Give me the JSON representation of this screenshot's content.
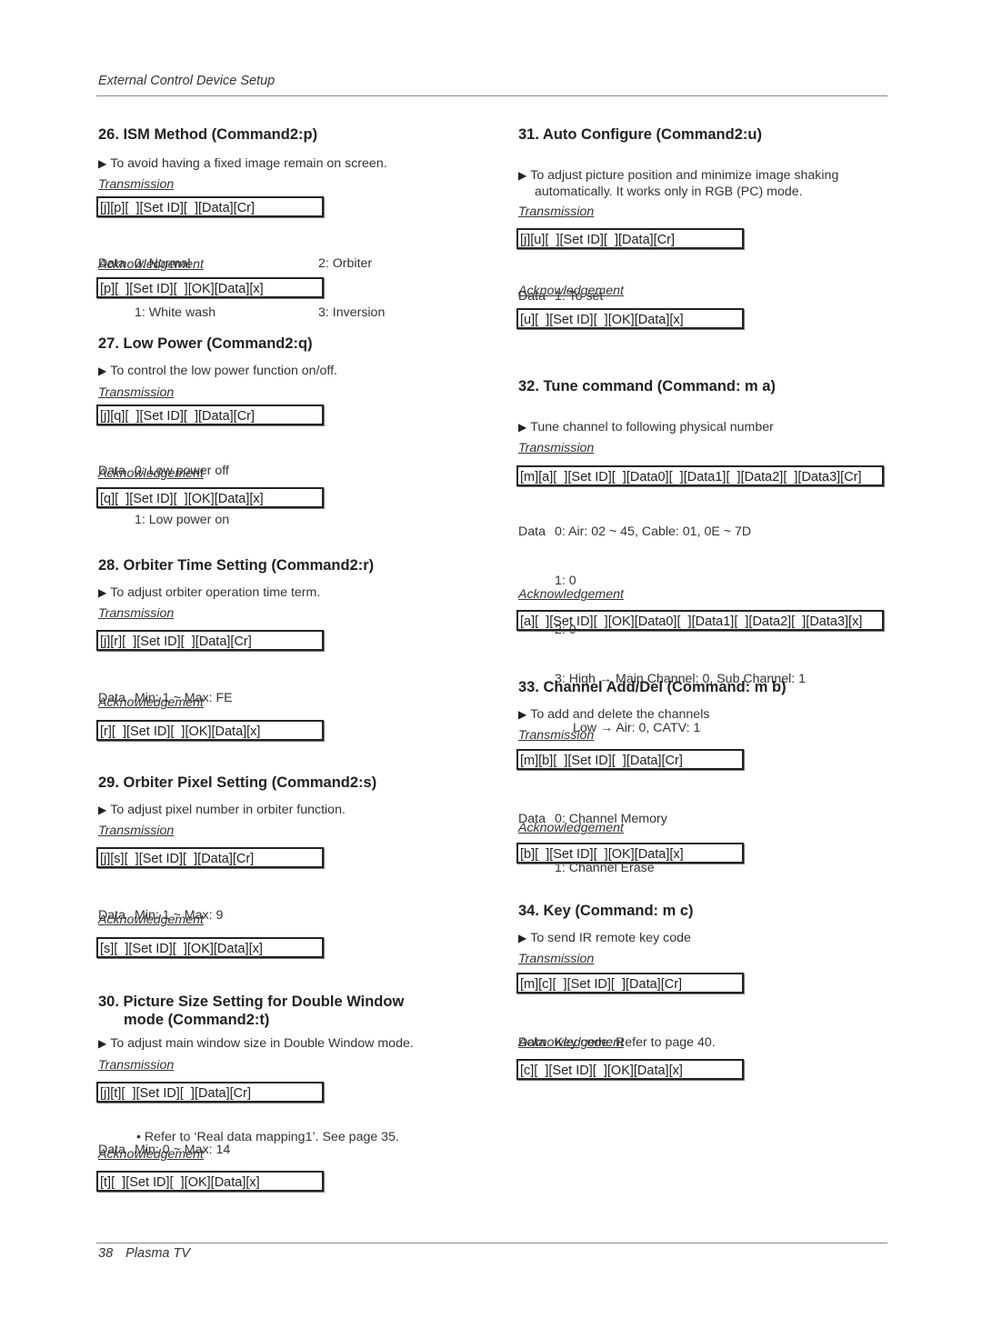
{
  "header": {
    "title": "External Control Device Setup"
  },
  "footer": {
    "page_number": "38",
    "product": "Plasma TV"
  },
  "labels": {
    "transmission": "Transmission",
    "acknowledgement": "Acknowledgement",
    "data": "Data"
  },
  "sections": [
    {
      "id": "26",
      "title": "26. ISM Method (Command2:p)",
      "description": "To avoid having a fixed image remain on screen.",
      "transmission": "[j][p][  ][Set ID][  ][Data][Cr]",
      "data_col1": [
        "0: Normal",
        "1: White wash"
      ],
      "data_col2": [
        "2: Orbiter",
        "3: Inversion"
      ],
      "acknowledgement": "[p][  ][Set ID][  ][OK][Data][x]"
    },
    {
      "id": "27",
      "title": "27. Low Power (Command2:q)",
      "description": "To control the low power function on/off.",
      "transmission": "[j][q][  ][Set ID][  ][Data][Cr]",
      "data": [
        "0: Low power off",
        "1: Low power on"
      ],
      "acknowledgement": "[q][  ][Set ID][  ][OK][Data][x]"
    },
    {
      "id": "28",
      "title": "28. Orbiter Time Setting (Command2:r)",
      "description": "To adjust orbiter operation time term.",
      "transmission": "[j][r][  ][Set ID][  ][Data][Cr]",
      "data": [
        "Min: 1 ~ Max: FE"
      ],
      "acknowledgement": "[r][  ][Set ID][  ][OK][Data][x]"
    },
    {
      "id": "29",
      "title": "29. Orbiter Pixel Setting (Command2:s)",
      "description": "To adjust pixel number in orbiter function.",
      "transmission": "[j][s][  ][Set ID][  ][Data][Cr]",
      "data": [
        "Min: 1 ~ Max: 9"
      ],
      "acknowledgement": "[s][  ][Set ID][  ][OK][Data][x]"
    },
    {
      "id": "30",
      "title_line1": "30. Picture Size Setting for Double Window",
      "title_line2": "mode (Command2:t)",
      "description": "To adjust main window size in Double Window mode.",
      "transmission": "[j][t][  ][Set ID][  ][Data][Cr]",
      "data": [
        "Min: 0 ~ Max: 14"
      ],
      "note": "• Refer to ‘Real data mapping1’. See page 35.",
      "acknowledgement": "[t][  ][Set ID][  ][OK][Data][x]"
    },
    {
      "id": "31",
      "title": "31. Auto Configure (Command2:u)",
      "description_line1": "To adjust picture position and minimize image shaking",
      "description_line2": "automatically. It works only in RGB (PC) mode.",
      "transmission": "[j][u][  ][Set ID][  ][Data][Cr]",
      "data": [
        "1: To set"
      ],
      "acknowledgement": "[u][  ][Set ID][  ][OK][Data][x]"
    },
    {
      "id": "32",
      "title": "32. Tune command (Command: m a)",
      "description": "Tune channel to following physical number",
      "transmission": "[m][a][  ][Set ID][  ][Data0][  ][Data1][  ][Data2][  ][Data3][Cr]",
      "data": [
        "0: Air: 02 ~ 45, Cable: 01, 0E ~ 7D",
        "1: 0",
        "2: 0",
        "3: High → Main Channel: 0, Sub Channel: 1"
      ],
      "data_cont": "Low → Air: 0, CATV: 1",
      "acknowledgement": "[a][  ][Set ID][  ][OK][Data0][  ][Data1][  ][Data2][  ][Data3][x]"
    },
    {
      "id": "33",
      "title": "33. Channel Add/Del (Command: m b)",
      "description": "To add and delete the channels",
      "transmission": "[m][b][  ][Set ID][  ][Data][Cr]",
      "data": [
        "0: Channel Memory",
        "1: Channel Erase"
      ],
      "acknowledgement": "[b][  ][Set ID][  ][OK][Data][x]"
    },
    {
      "id": "34",
      "title": "34. Key (Command: m c)",
      "description": "To send IR remote key code",
      "transmission": "[m][c][  ][Set ID][  ][Data][Cr]",
      "data": [
        "Key code: Refer to page 40."
      ],
      "acknowledgement": "[c][  ][Set ID][  ][OK][Data][x]"
    }
  ]
}
